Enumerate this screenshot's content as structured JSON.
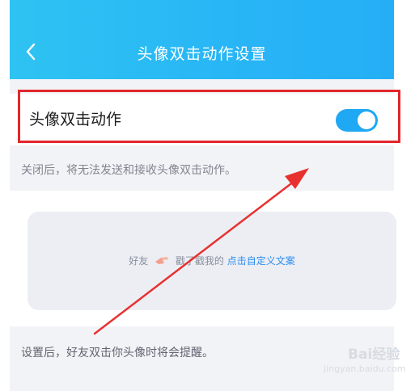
{
  "header": {
    "title": "头像双击动作设置",
    "back_icon": "chevron-left-icon"
  },
  "toggle_row": {
    "label": "头像双击动作",
    "enabled": true,
    "accent_color": "#1fa8f4"
  },
  "description_off": "关闭后，将无法发送和接收头像双击动作。",
  "preview": {
    "prefix": "好友",
    "middle": "戳了戳我的",
    "link": "点击自定义文案",
    "link_color": "#2c8df0"
  },
  "description_after": "设置后，好友双击你头像时将会提醒。",
  "watermark": {
    "brand": "Bai经验",
    "site": "jingyan.baidu.com"
  },
  "colors": {
    "header": "#28b5f6",
    "highlight_border": "#e2262c",
    "arrow": "#e8312f"
  }
}
